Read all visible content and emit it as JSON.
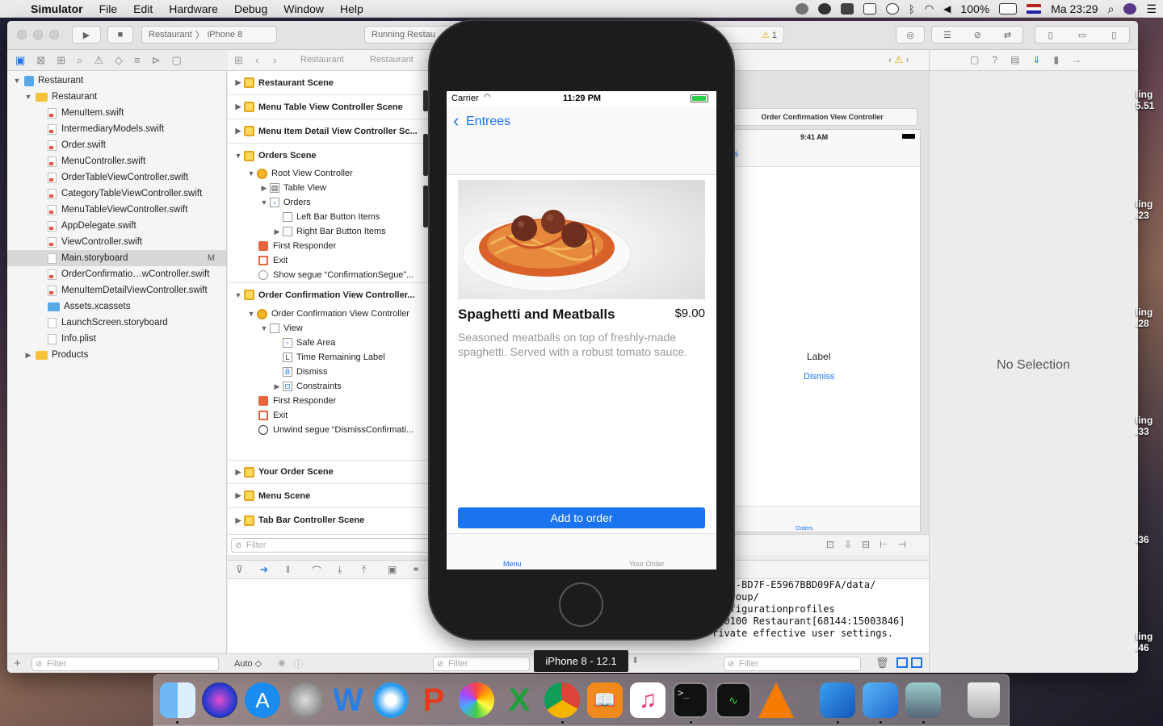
{
  "menubar": {
    "app": "Simulator",
    "items": [
      "File",
      "Edit",
      "Hardware",
      "Debug",
      "Window",
      "Help"
    ],
    "battery": "100%",
    "clock": "Ma 23:29"
  },
  "toolbar": {
    "scheme": "Restaurant",
    "device": "iPhone 8",
    "status": "Running Restau",
    "warnings": "1"
  },
  "jumpbar": {
    "crumb1": "Restaurant",
    "crumb2": "Restaurant"
  },
  "navigator": {
    "items": [
      {
        "label": "Restaurant",
        "type": "project"
      },
      {
        "label": "Restaurant",
        "type": "folder"
      },
      {
        "label": "MenuItem.swift",
        "type": "swift"
      },
      {
        "label": "IntermediaryModels.swift",
        "type": "swift"
      },
      {
        "label": "Order.swift",
        "type": "swift"
      },
      {
        "label": "MenuController.swift",
        "type": "swift"
      },
      {
        "label": "OrderTableViewController.swift",
        "type": "swift"
      },
      {
        "label": "CategoryTableViewController.swift",
        "type": "swift"
      },
      {
        "label": "MenuTableViewController.swift",
        "type": "swift"
      },
      {
        "label": "AppDelegate.swift",
        "type": "swift"
      },
      {
        "label": "ViewController.swift",
        "type": "swift"
      },
      {
        "label": "Main.storyboard",
        "type": "storyboard",
        "badge": "M"
      },
      {
        "label": "OrderConfirmatio…wController.swift",
        "type": "swift"
      },
      {
        "label": "MenuItemDetailViewController.swift",
        "type": "swift"
      },
      {
        "label": "Assets.xcassets",
        "type": "assets"
      },
      {
        "label": "LaunchScreen.storyboard",
        "type": "storyboard"
      },
      {
        "label": "Info.plist",
        "type": "plist"
      },
      {
        "label": "Products",
        "type": "folder"
      }
    ],
    "filter_placeholder": "Filter"
  },
  "outline": {
    "scene_restaurant": "Restaurant Scene",
    "scene_menu_table": "Menu Table View Controller Scene",
    "scene_menu_detail": "Menu Item Detail View Controller Sc...",
    "scene_orders": "Orders Scene",
    "root_vc": "Root View Controller",
    "table_view": "Table View",
    "orders": "Orders",
    "left_bar": "Left Bar Button Items",
    "right_bar": "Right Bar Button Items",
    "first_responder": "First Responder",
    "exit": "Exit",
    "show_segue": "Show segue “ConfirmationSegue”...",
    "scene_order_conf": "Order Confirmation View Controller...",
    "order_conf_vc": "Order Confirmation View Controller",
    "view": "View",
    "safe_area": "Safe Area",
    "time_label": "Time Remaining Label",
    "dismiss": "Dismiss",
    "constraints": "Constraints",
    "first_responder2": "First Responder",
    "exit2": "Exit",
    "unwind_segue": "Unwind segue “DismissConfirmati...",
    "scene_your_order": "Your Order Scene",
    "scene_menu": "Menu Scene",
    "scene_tabbar": "Tab Bar Controller Scene",
    "filter_placeholder": "Filter"
  },
  "canvas": {
    "vc_title": "Order Confirmation View Controller",
    "time": "9:41 AM",
    "nav_fragment": "rs",
    "label": "Label",
    "dismiss": "Dismiss",
    "tab_fragment": "Orders"
  },
  "inspector": {
    "no_selection": "No Selection"
  },
  "debug": {
    "auto": "Auto ◇",
    "filter_placeholder": "Filter",
    "console_lines": [
      "4E6F-BD7F-E5967BBD09FA/data/",
      "emGroup/",
      "configurationprofiles",
      "7+0100 Restaurant[68144:15003846]",
      "rivate effective user settings."
    ],
    "right_filter_placeholder": "Filter"
  },
  "simulator": {
    "carrier": "Carrier",
    "time": "11:29 PM",
    "back_label": "Entrees",
    "item_name": "Spaghetti and Meatballs",
    "price": "$9.00",
    "description": "Seasoned meatballs on top of freshly-made spaghetti. Served with a robust tomato sauce.",
    "add_button": "Add to order",
    "tab_menu": "Menu",
    "tab_your_order": "Your Order",
    "device_label": "iPhone 8 - 12.1"
  },
  "desktop": {
    "labels": [
      "ling\n5.51",
      "ling\n.23",
      "ling\n.28",
      "ling\n.33",
      "\n.36",
      "ling\n.46"
    ]
  },
  "colors": {
    "accent": "#1a74f0",
    "tabActive": "#1a74f0",
    "scene": "#f3b727"
  }
}
